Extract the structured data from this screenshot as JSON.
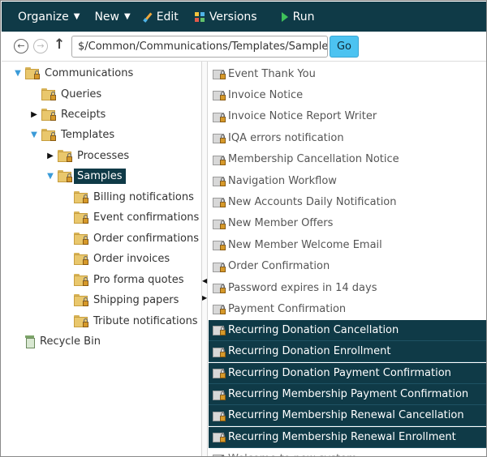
{
  "toolbar": {
    "organize": "Organize",
    "new": "New",
    "edit": "Edit",
    "versions": "Versions",
    "run": "Run",
    "caret": "▼"
  },
  "address": {
    "back": "←",
    "forward": "→",
    "up": "↑",
    "path": "$/Common/Communications/Templates/Samples",
    "go": "Go"
  },
  "tree": [
    {
      "label": "Communications",
      "level": 0,
      "toggle": "open",
      "icon": "folder"
    },
    {
      "label": "Queries",
      "level": 1,
      "toggle": "none",
      "icon": "folder"
    },
    {
      "label": "Receipts",
      "level": 1,
      "toggle": "closed",
      "icon": "folder"
    },
    {
      "label": "Templates",
      "level": 1,
      "toggle": "open",
      "icon": "folder"
    },
    {
      "label": "Processes",
      "level": 2,
      "toggle": "closed",
      "icon": "folder"
    },
    {
      "label": "Samples",
      "level": 2,
      "toggle": "open",
      "icon": "folder",
      "selected": true
    },
    {
      "label": "Billing notifications",
      "level": 3,
      "toggle": "none",
      "icon": "folder"
    },
    {
      "label": "Event confirmations",
      "level": 3,
      "toggle": "none",
      "icon": "folder"
    },
    {
      "label": "Order confirmations",
      "level": 3,
      "toggle": "none",
      "icon": "folder"
    },
    {
      "label": "Order invoices",
      "level": 3,
      "toggle": "none",
      "icon": "folder"
    },
    {
      "label": "Pro forma quotes",
      "level": 3,
      "toggle": "none",
      "icon": "folder"
    },
    {
      "label": "Shipping papers",
      "level": 3,
      "toggle": "none",
      "icon": "folder"
    },
    {
      "label": "Tribute notifications",
      "level": 3,
      "toggle": "none",
      "icon": "folder"
    },
    {
      "label": "Recycle Bin",
      "level": 0,
      "toggle": "none",
      "icon": "bin"
    }
  ],
  "list": [
    {
      "label": "Event Thank You",
      "selected": false
    },
    {
      "label": "Invoice Notice",
      "selected": false
    },
    {
      "label": "Invoice Notice Report Writer",
      "selected": false
    },
    {
      "label": "IQA errors notification",
      "selected": false
    },
    {
      "label": "Membership Cancellation Notice",
      "selected": false
    },
    {
      "label": "Navigation Workflow",
      "selected": false
    },
    {
      "label": "New Accounts Daily Notification",
      "selected": false
    },
    {
      "label": "New Member Offers",
      "selected": false
    },
    {
      "label": "New Member Welcome Email",
      "selected": false
    },
    {
      "label": "Order Confirmation",
      "selected": false
    },
    {
      "label": "Password expires in 14 days",
      "selected": false
    },
    {
      "label": "Payment Confirmation",
      "selected": false
    },
    {
      "label": "Recurring Donation Cancellation",
      "selected": true
    },
    {
      "label": "Recurring Donation Enrollment",
      "selected": true
    },
    {
      "label": "Recurring Donation Payment Confirmation",
      "selected": true
    },
    {
      "label": "Recurring Membership Payment Confirmation",
      "selected": true
    },
    {
      "label": "Recurring Membership Renewal Cancellation",
      "selected": true
    },
    {
      "label": "Recurring Membership Renewal Enrollment",
      "selected": true
    },
    {
      "label": "Welcome to new system",
      "selected": false
    }
  ],
  "splitter": {
    "left_arrow": "◀",
    "right_arrow": "▶"
  },
  "colors": {
    "toolbar_bg": "#0f3a47",
    "selection_bg": "#0f3a47",
    "go_button": "#4cc3f1"
  }
}
